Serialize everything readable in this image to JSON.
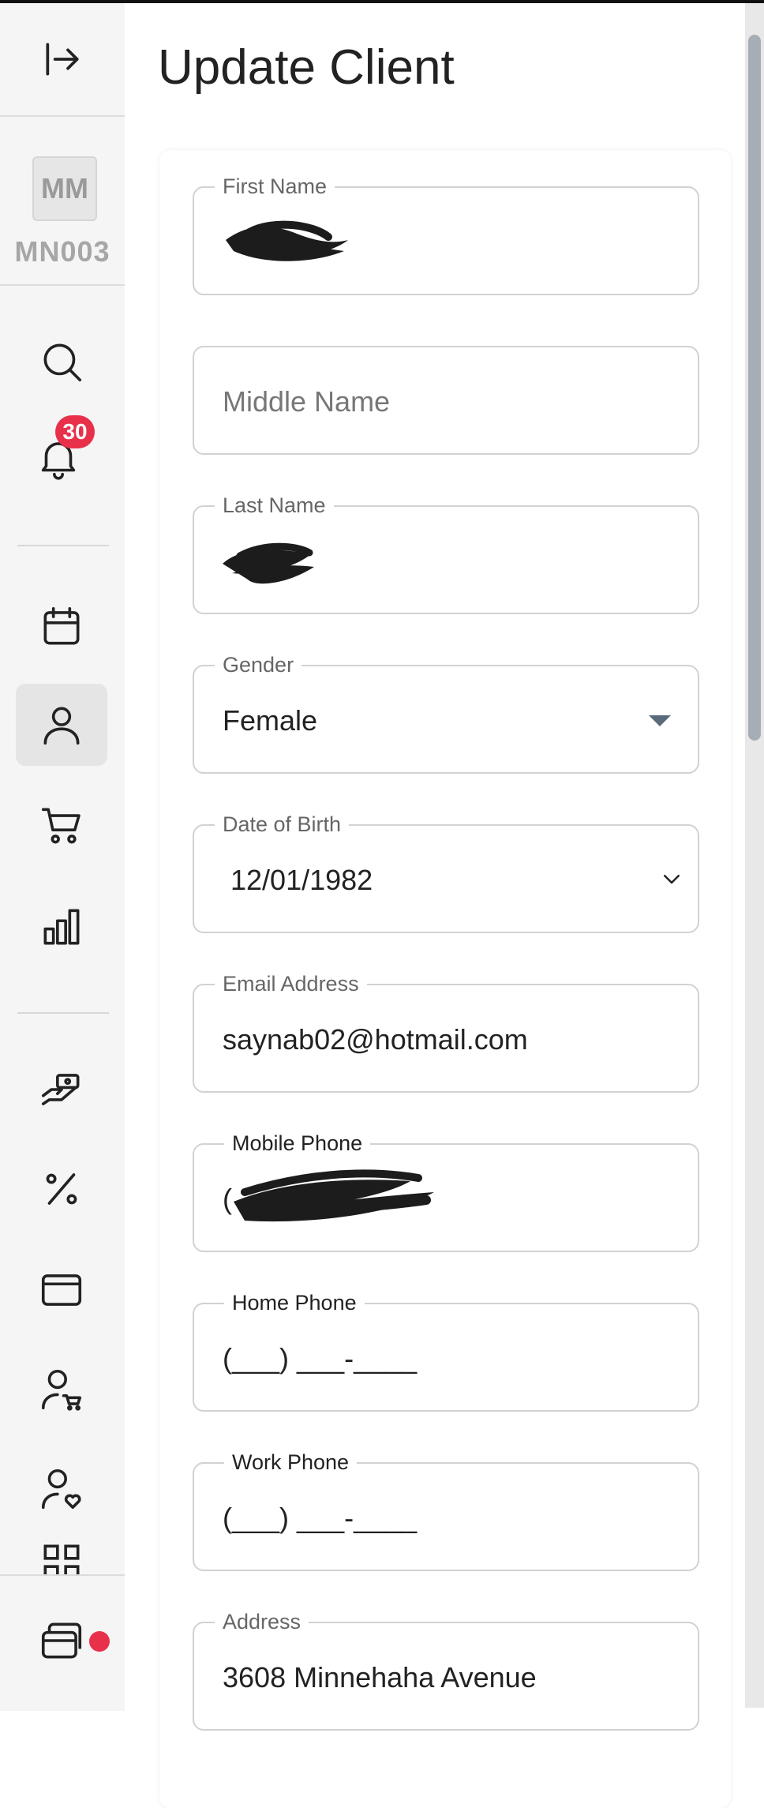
{
  "page": {
    "title": "Update Client"
  },
  "sidebar": {
    "user_initials": "MM",
    "user_code": "MN003",
    "notification_count": "30",
    "icons": [
      "collapse-icon",
      "search-icon",
      "bell-icon",
      "calendar-icon",
      "user-icon",
      "cart-icon",
      "bar-chart-icon",
      "money-hand-icon",
      "percent-icon",
      "credit-card-icon",
      "user-cart-icon",
      "user-heart-icon",
      "grid-icon",
      "wallet-icon"
    ]
  },
  "form": {
    "first_name": {
      "label": "First Name",
      "value": ""
    },
    "middle_name": {
      "placeholder": "Middle Name"
    },
    "last_name": {
      "label": "Last Name",
      "value": ""
    },
    "gender": {
      "label": "Gender",
      "value": "Female"
    },
    "dob": {
      "label": "Date of Birth",
      "value": "12/01/1982"
    },
    "email": {
      "label": "Email Address",
      "value": "saynab02@hotmail.com"
    },
    "mobile_phone": {
      "label": "Mobile Phone",
      "value": "("
    },
    "home_phone": {
      "label": "Home Phone",
      "value": "(___) ___-____"
    },
    "work_phone": {
      "label": "Work Phone",
      "value": "(___) ___-____"
    },
    "address": {
      "label": "Address",
      "value": "3608 Minnehaha Avenue"
    }
  },
  "colors": {
    "badge": "#e8304a",
    "scroll_thumb": "#a7adb6"
  }
}
